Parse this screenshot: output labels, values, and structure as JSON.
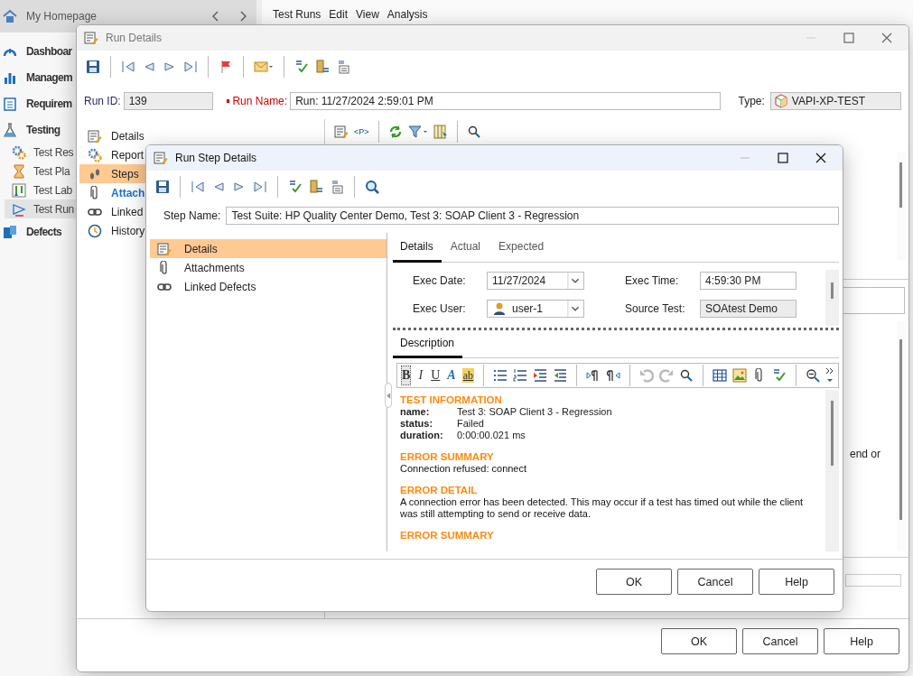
{
  "top_bar": {
    "title": "My Homepage"
  },
  "sidebar": {
    "items": [
      {
        "label": "Dashboar",
        "kind": "module",
        "selected": false
      },
      {
        "label": "Managem",
        "kind": "module",
        "selected": false
      },
      {
        "label": "Requirem",
        "kind": "module",
        "selected": false
      },
      {
        "label": "Testing",
        "kind": "module",
        "selected": false
      },
      {
        "label": "Test Res",
        "kind": "page",
        "selected": false
      },
      {
        "label": "Test Pla",
        "kind": "page",
        "selected": false
      },
      {
        "label": "Test Lab",
        "kind": "page",
        "selected": false
      },
      {
        "label": "Test Run",
        "kind": "page",
        "selected": true
      },
      {
        "label": "Defects",
        "kind": "module",
        "selected": false
      }
    ]
  },
  "menu_bar": {
    "items": [
      "Test Runs",
      "Edit",
      "View",
      "Analysis"
    ]
  },
  "run_details": {
    "title": "Run Details",
    "run_id": {
      "label": "Run ID:",
      "value": "139"
    },
    "run_name": {
      "label": "Run Name:",
      "value": "Run: 11/27/2024 2:59:01 PM",
      "required": true
    },
    "type": {
      "label": "Type:",
      "value": "VAPI-XP-TEST"
    },
    "nav": [
      {
        "label": "Details",
        "selected": false,
        "emphasized": false
      },
      {
        "label": "Report",
        "selected": false,
        "emphasized": false
      },
      {
        "label": "Steps",
        "selected": true,
        "emphasized": false
      },
      {
        "label": "Attach",
        "selected": false,
        "emphasized": true
      },
      {
        "label": "Linked",
        "selected": false,
        "emphasized": false
      },
      {
        "label": "History",
        "selected": false,
        "emphasized": false
      }
    ],
    "panel_toolbar": {
      "tag_label": "<P>"
    },
    "panel_text": "end or",
    "buttons": [
      "OK",
      "Cancel",
      "Help"
    ]
  },
  "run_step_details": {
    "title": "Run Step Details",
    "step_name": {
      "label": "Step Name:",
      "value": "Test Suite: HP Quality Center Demo, Test 3: SOAP Client 3 - Regression"
    },
    "nav": [
      {
        "label": "Details",
        "selected": true
      },
      {
        "label": "Attachments",
        "selected": false
      },
      {
        "label": "Linked Defects",
        "selected": false
      }
    ],
    "tabs": [
      {
        "label": "Details",
        "selected": true
      },
      {
        "label": "Actual",
        "selected": false
      },
      {
        "label": "Expected",
        "selected": false
      }
    ],
    "fields": [
      {
        "label": "Exec Date:",
        "value": "11/27/2024",
        "kind": "dropdown"
      },
      {
        "label": "Exec Time:",
        "value": "4:59:30 PM",
        "kind": "text"
      },
      {
        "label": "Exec User:",
        "value": "user-1",
        "kind": "user"
      },
      {
        "label": "Source Test:",
        "value": "SOAtest Demo",
        "kind": "readonly"
      }
    ],
    "description_tabs": [
      {
        "label": "Description",
        "selected": true
      }
    ],
    "editor_toolbar": {
      "format_buttons": [
        {
          "label": "B",
          "selected": true
        },
        {
          "label": "I",
          "selected": false
        },
        {
          "label": "U",
          "selected": false
        },
        {
          "label": "A",
          "selected": false
        },
        {
          "label": "ab",
          "selected": false
        }
      ]
    },
    "description": [
      {
        "heading": "TEST INFORMATION",
        "rows": [
          {
            "key": "name:",
            "value": "Test 3: SOAP Client 3 - Regression"
          },
          {
            "key": "status:",
            "value": "Failed"
          },
          {
            "key": "duration:",
            "value": "0:00:00.021 ms"
          }
        ]
      },
      {
        "heading": "ERROR SUMMARY",
        "text": "Connection refused: connect"
      },
      {
        "heading": "ERROR DETAIL",
        "text": "A connection error has been detected. This may occur if a test has timed out while the client was still attempting to send or receive data."
      },
      {
        "heading": "ERROR SUMMARY"
      }
    ],
    "buttons": [
      "OK",
      "Cancel",
      "Help"
    ]
  }
}
